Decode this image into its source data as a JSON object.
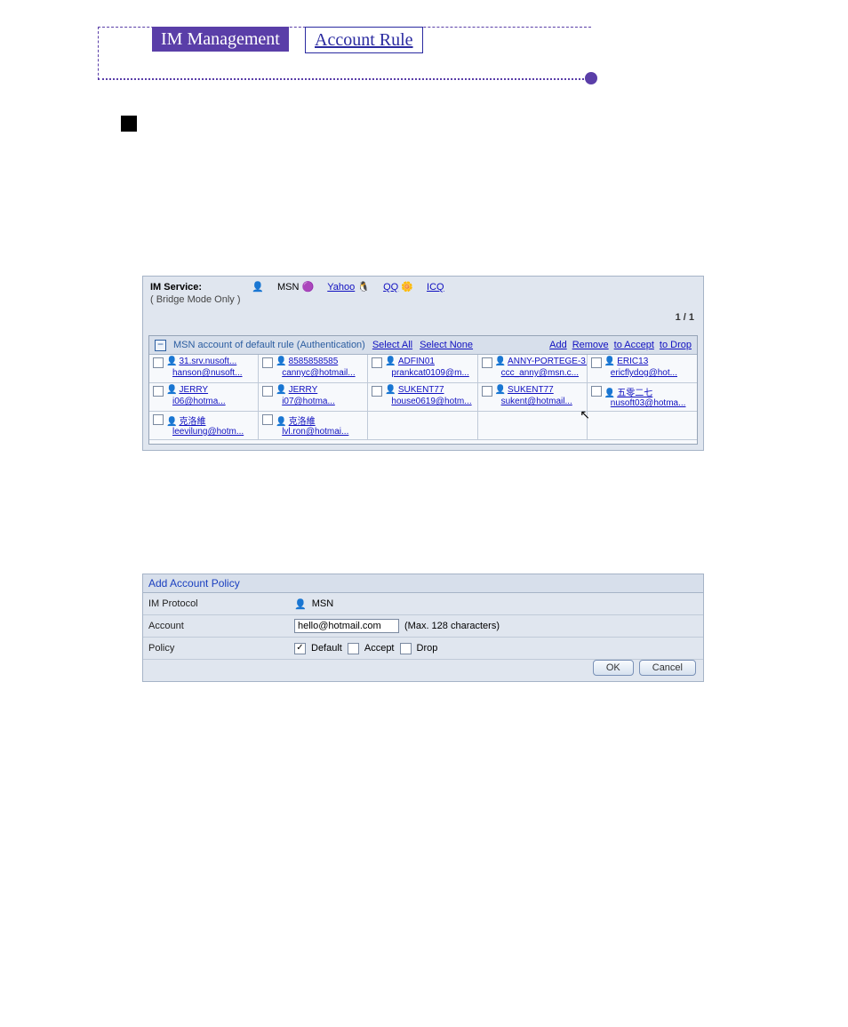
{
  "crumb": {
    "solid": "IM Management",
    "outline": "Account Rule"
  },
  "ss1": {
    "service_label": "IM Service:",
    "services": [
      "MSN",
      "Yahoo",
      "QQ",
      "ICQ"
    ],
    "bridge_note": "( Bridge Mode Only )",
    "pager": "1 / 1",
    "grid_title": "MSN account of default rule (Authentication)",
    "head_links": {
      "select_all": "Select All",
      "select_none": "Select None",
      "add": "Add",
      "remove": "Remove",
      "to_accept": "to Accept",
      "to_drop": "to Drop"
    },
    "cells": [
      {
        "name": "31.srv.nusoft...",
        "mail": "hanson@nusoft..."
      },
      {
        "name": "8585858585",
        "mail": "cannyc@hotmail..."
      },
      {
        "name": "ADFIN01",
        "mail": "prankcat0109@m..."
      },
      {
        "name": "ANNY-PORTEGE-3...",
        "mail": "ccc_anny@msn.c..."
      },
      {
        "name": "ERIC13",
        "mail": "ericflydog@hot..."
      },
      {
        "name": "JERRY",
        "mail": "i06@hotma..."
      },
      {
        "name": "JERRY",
        "mail": "i07@hotma..."
      },
      {
        "name": "SUKENT77",
        "mail": "house0619@hotm..."
      },
      {
        "name": "SUKENT77",
        "mail": "sukent@hotmail..."
      },
      {
        "name": "五零二七",
        "mail": "nusoft03@hotma..."
      },
      {
        "name": "克洛維",
        "mail": "leevilung@hotm..."
      },
      {
        "name": "克洛維",
        "mail": "lvl.ron@hotmai..."
      },
      null,
      null,
      null
    ]
  },
  "ss2": {
    "title": "Add Account Policy",
    "rows": {
      "protocol_label": "IM Protocol",
      "protocol_value": "MSN",
      "account_label": "Account",
      "account_value": "hello@hotmail.com",
      "account_hint": "(Max. 128 characters)",
      "policy_label": "Policy",
      "policy_default": "Default",
      "policy_accept": "Accept",
      "policy_drop": "Drop"
    },
    "buttons": {
      "ok": "OK",
      "cancel": "Cancel"
    }
  }
}
